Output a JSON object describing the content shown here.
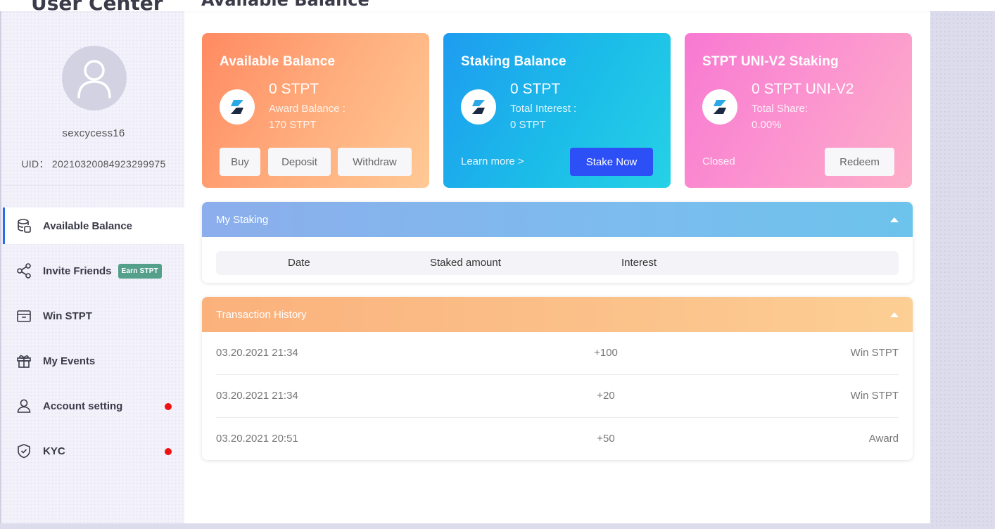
{
  "sidebar": {
    "title": "User Center",
    "username": "sexcycess16",
    "uid": "UID： 20210320084923299975",
    "nav": [
      {
        "label": "Available Balance",
        "icon": "database-icon",
        "active": true
      },
      {
        "label": "Invite Friends",
        "icon": "share-icon",
        "badge": "Earn STPT"
      },
      {
        "label": "Win STPT",
        "icon": "box-icon"
      },
      {
        "label": "My Events",
        "icon": "gift-icon"
      },
      {
        "label": "Account setting",
        "icon": "user-icon",
        "dot": true
      },
      {
        "label": "KYC",
        "icon": "shield-icon",
        "dot": true
      }
    ]
  },
  "main": {
    "heading": "Available Balance"
  },
  "cards": {
    "available": {
      "title": "Available Balance",
      "amount": "0 STPT",
      "sub1": "Award Balance :",
      "sub2": "170 STPT",
      "buy": "Buy",
      "deposit": "Deposit",
      "withdraw": "Withdraw"
    },
    "staking": {
      "title": "Staking Balance",
      "amount": "0 STPT",
      "sub1": "Total Interest :",
      "sub2": "0 STPT",
      "learn_more": "Learn more >",
      "stake_now": "Stake Now"
    },
    "uni": {
      "title": "STPT UNI-V2 Staking",
      "amount": "0 STPT UNI-V2",
      "sub1": "Total Share:",
      "sub2": "0.00%",
      "status": "Closed",
      "redeem": "Redeem"
    }
  },
  "my_staking": {
    "title": "My Staking",
    "columns": [
      "Date",
      "Staked amount",
      "Interest"
    ]
  },
  "transactions": {
    "title": "Transaction History",
    "rows": [
      {
        "date": "03.20.2021 21:34",
        "amount": "+100",
        "type": "Win STPT"
      },
      {
        "date": "03.20.2021 21:34",
        "amount": "+20",
        "type": "Win STPT"
      },
      {
        "date": "03.20.2021 20:51",
        "amount": "+50",
        "type": "Award"
      }
    ]
  },
  "colors": {
    "accent_blue": "#2c4ff6",
    "badge_green": "#55a08b",
    "alert_red": "#ee1111"
  }
}
